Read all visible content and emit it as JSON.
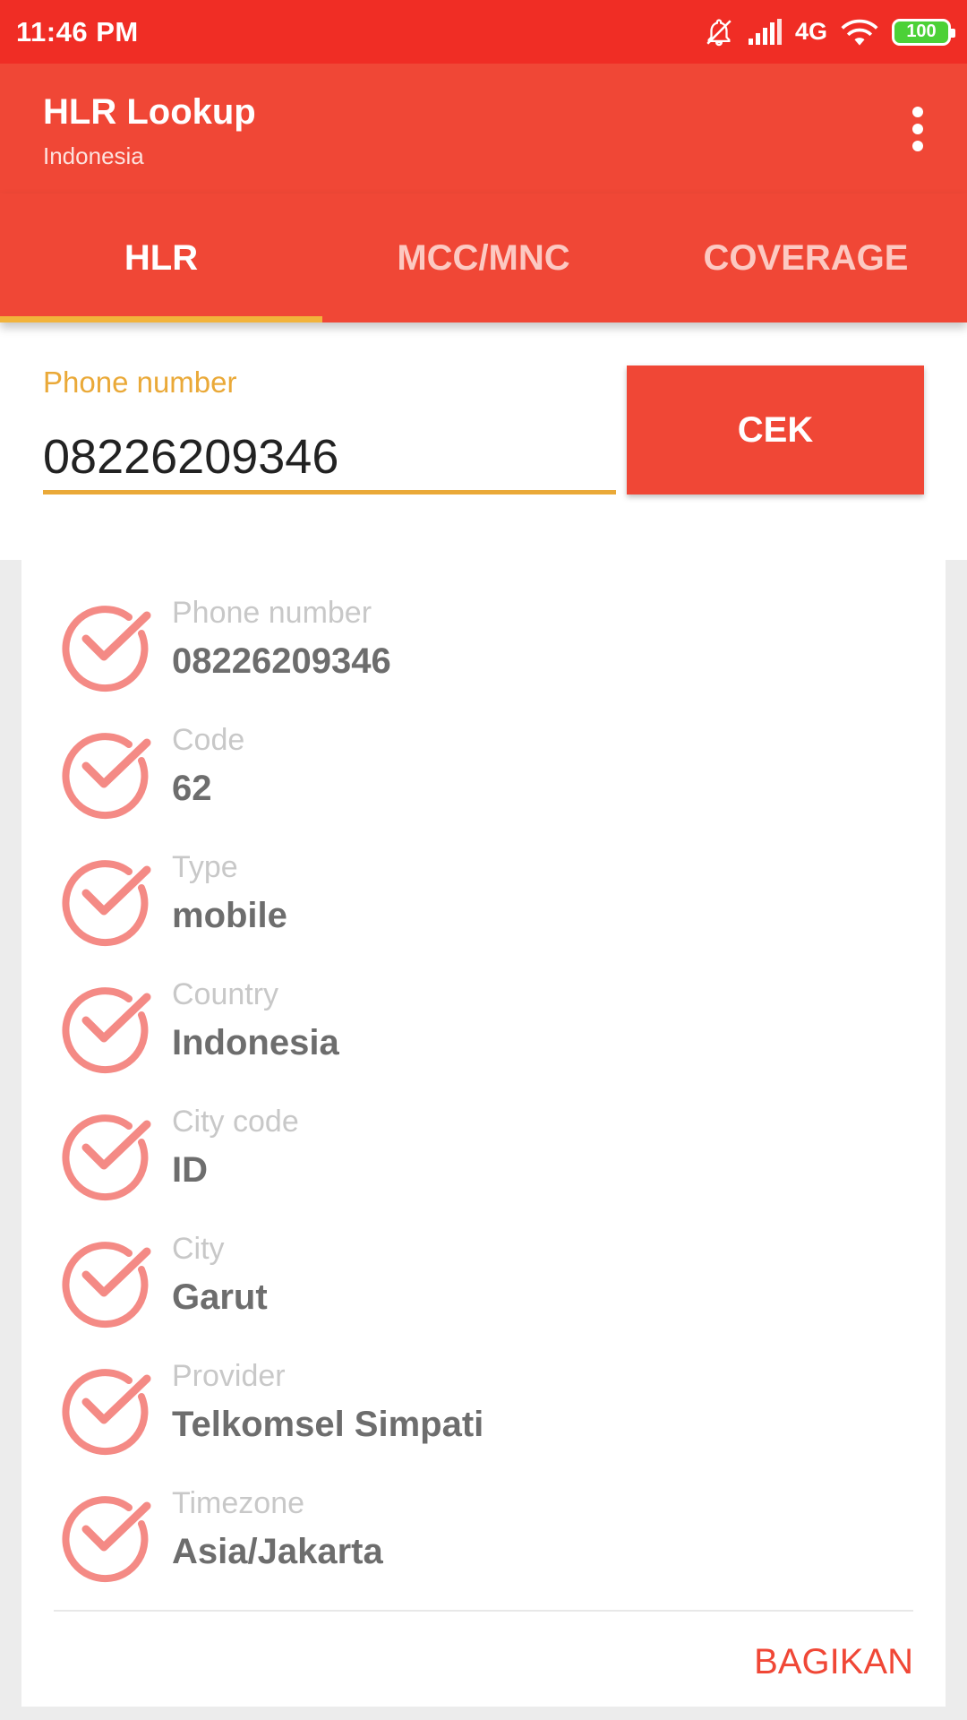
{
  "status_bar": {
    "time": "11:46 PM",
    "network": "4G",
    "battery": "100",
    "icons": [
      "bell-off-icon",
      "signal-icon",
      "wifi-icon",
      "battery-icon"
    ]
  },
  "app_bar": {
    "title": "HLR Lookup",
    "subtitle": "Indonesia",
    "menu_icon": "more-vert-icon"
  },
  "tabs": [
    {
      "label": "HLR",
      "active": true
    },
    {
      "label": "MCC/MNC",
      "active": false
    },
    {
      "label": "COVERAGE",
      "active": false
    }
  ],
  "form": {
    "label": "Phone number",
    "value": "08226209346",
    "button_label": "CEK"
  },
  "results": [
    {
      "label": "Phone number",
      "value": "08226209346"
    },
    {
      "label": "Code",
      "value": "62"
    },
    {
      "label": "Type",
      "value": "mobile"
    },
    {
      "label": "Country",
      "value": "Indonesia"
    },
    {
      "label": "City code",
      "value": "ID"
    },
    {
      "label": "City",
      "value": "Garut"
    },
    {
      "label": "Provider",
      "value": "Telkomsel Simpati"
    },
    {
      "label": "Timezone",
      "value": "Asia/Jakarta"
    }
  ],
  "share_label": "BAGIKAN",
  "colors": {
    "status_bar": "#f02d25",
    "primary": "#f04736",
    "accent": "#eaa938",
    "tab_indicator": "#f2b33b",
    "check_icon": "#f48a85"
  }
}
